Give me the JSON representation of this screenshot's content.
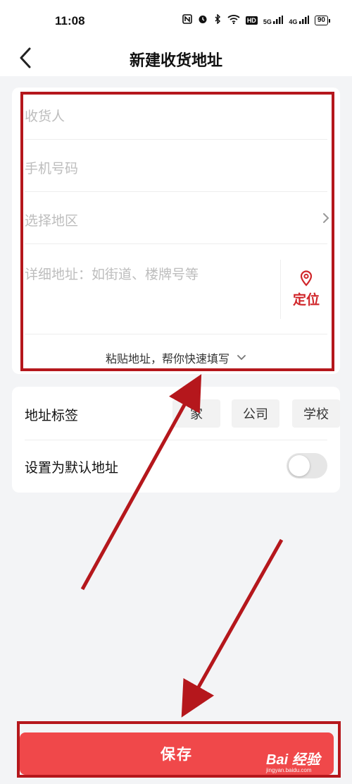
{
  "status_bar": {
    "time": "11:08",
    "icons": [
      "nfc-icon",
      "alarm-icon",
      "bluetooth-icon",
      "wifi-icon",
      "hd-icon",
      "signal-5g-icon",
      "signal-4g-icon"
    ],
    "network_1": "5G",
    "network_2": "4G",
    "hd_label": "HD",
    "battery": "90"
  },
  "header": {
    "title": "新建收货地址"
  },
  "form": {
    "name_placeholder": "收货人",
    "phone_placeholder": "手机号码",
    "region_placeholder": "选择地区",
    "detail_placeholder": "详细地址：如街道、楼牌号等",
    "locate_label": "定位",
    "paste_label": "粘贴地址，帮你快速填写"
  },
  "tags": {
    "title": "地址标签",
    "options": [
      "家",
      "公司",
      "学校"
    ]
  },
  "default_address": {
    "label": "设置为默认地址",
    "enabled": false
  },
  "save_button": {
    "label": "保存"
  },
  "watermark": {
    "text": "Bai 经验",
    "sub": "jingyan.baidu.com"
  },
  "colors": {
    "accent": "#d0262a",
    "save_button": "#f0484a",
    "annotation": "#b5171c",
    "background": "#f3f4f6"
  }
}
